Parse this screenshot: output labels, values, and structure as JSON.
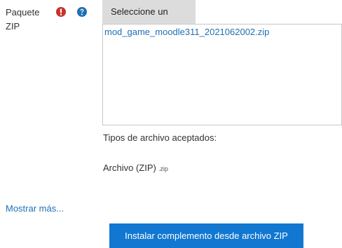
{
  "field": {
    "label": "Paquete ZIP",
    "required_icon": "exclamation-circle-icon",
    "help_icon": "question-circle-icon",
    "required_color": "#c9302c",
    "help_color": "#1f6fb5"
  },
  "filepicker": {
    "choose_label": "Seleccione un archivo...",
    "selected_file": "mod_game_moodle311_2021062002.zip"
  },
  "accepted_types": {
    "title": "Tipos de archivo aceptados:",
    "item_label": "Archivo (ZIP)",
    "item_ext": ".zip"
  },
  "show_more_label": "Mostrar más...",
  "install_button_label": "Instalar complemento desde archivo ZIP",
  "colors": {
    "accent": "#1177d1",
    "link": "#1f6fb5",
    "button_gray": "#dcdcdc"
  }
}
